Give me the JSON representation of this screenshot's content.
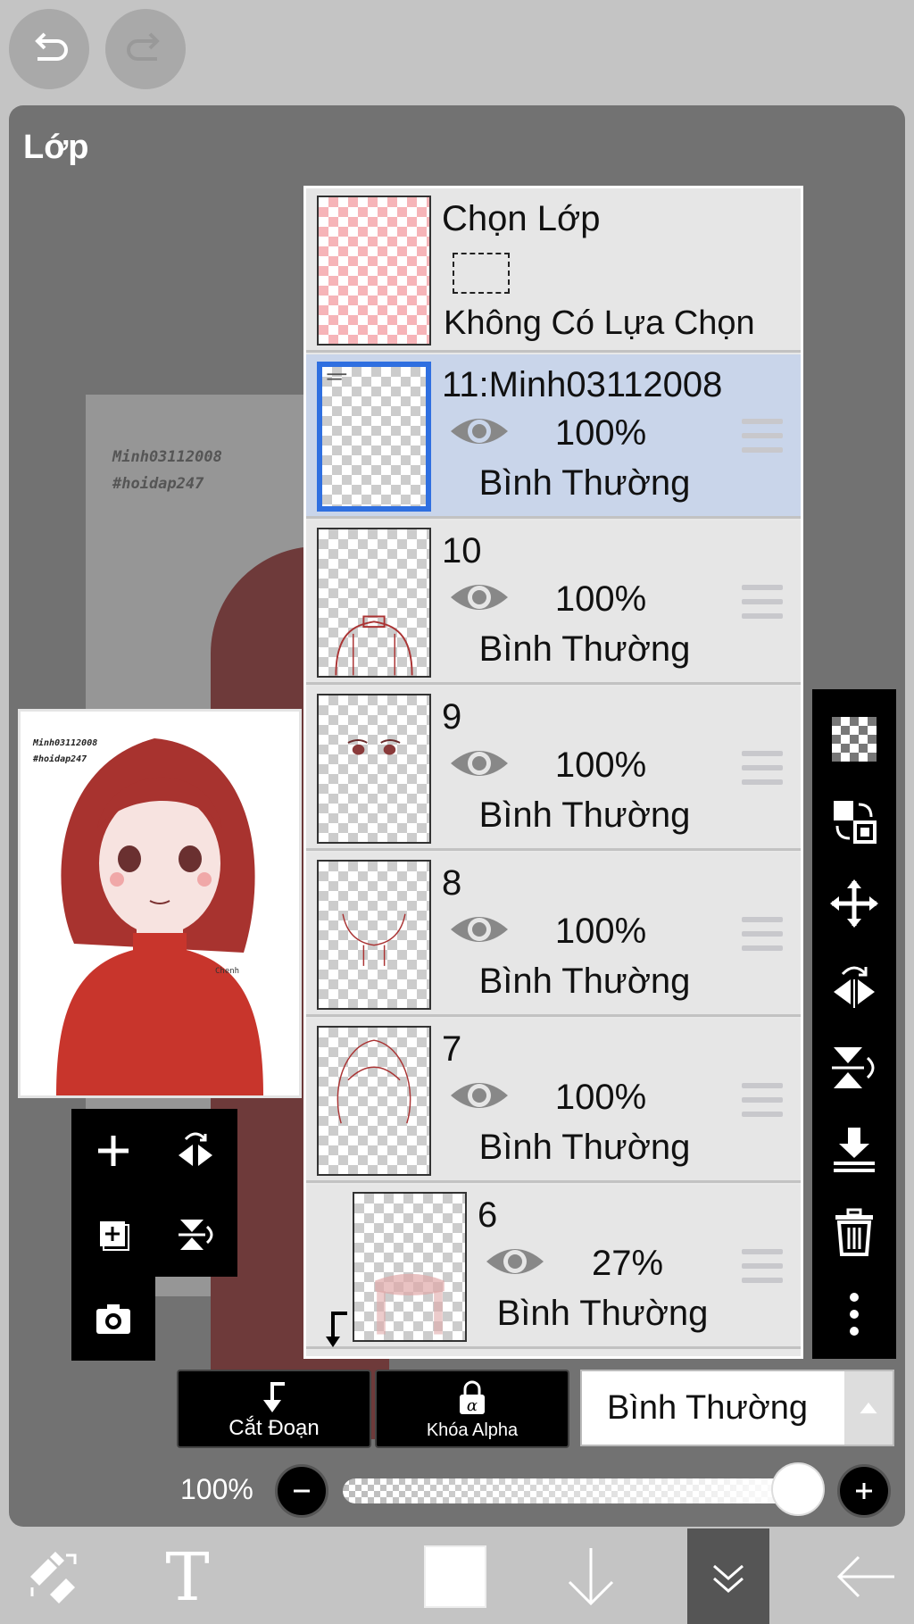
{
  "top_bar": {
    "undo_icon": "undo-icon",
    "redo_icon": "redo-icon"
  },
  "panel": {
    "title": "Lớp"
  },
  "canvas": {
    "watermark_line1": "Minh03112008",
    "watermark_line2": "#hoidap247"
  },
  "preview": {
    "watermark_line1": "Minh03112008",
    "watermark_line2": "#hoidap247",
    "signature": "Chenh"
  },
  "selection_row": {
    "title": "Chọn Lớp",
    "status": "Không Có Lựa Chọn"
  },
  "layers": [
    {
      "name": "11:Minh03112008",
      "opacity": "100%",
      "blend": "Bình Thường",
      "selected": true
    },
    {
      "name": "10",
      "opacity": "100%",
      "blend": "Bình Thường",
      "selected": false
    },
    {
      "name": "9",
      "opacity": "100%",
      "blend": "Bình Thường",
      "selected": false
    },
    {
      "name": "8",
      "opacity": "100%",
      "blend": "Bình Thường",
      "selected": false
    },
    {
      "name": "7",
      "opacity": "100%",
      "blend": "Bình Thường",
      "selected": false
    },
    {
      "name": "6",
      "opacity": "27%",
      "blend": "Bình Thường",
      "selected": false
    }
  ],
  "left_tools": [
    "add-layer-icon",
    "flip-horizontal-icon",
    "add-copy-icon",
    "flip-vertical-icon",
    "camera-icon"
  ],
  "right_tools": [
    "transparency-icon",
    "swap-layers-icon",
    "move-icon",
    "flip-horizontal-icon",
    "flip-vertical-icon",
    "merge-down-icon",
    "trash-icon",
    "more-icon"
  ],
  "actions": {
    "clip_label": "Cắt Đoạn",
    "alpha_lock_label": "Khóa Alpha",
    "blend_mode": "Bình Thường"
  },
  "opacity_control": {
    "label": "100%",
    "value": 1.0
  },
  "bottom_bar": [
    "tool-swap-icon",
    "text-tool-icon",
    "color-swatch",
    "down-arrow-icon",
    "collapse-icon",
    "back-arrow-icon"
  ]
}
